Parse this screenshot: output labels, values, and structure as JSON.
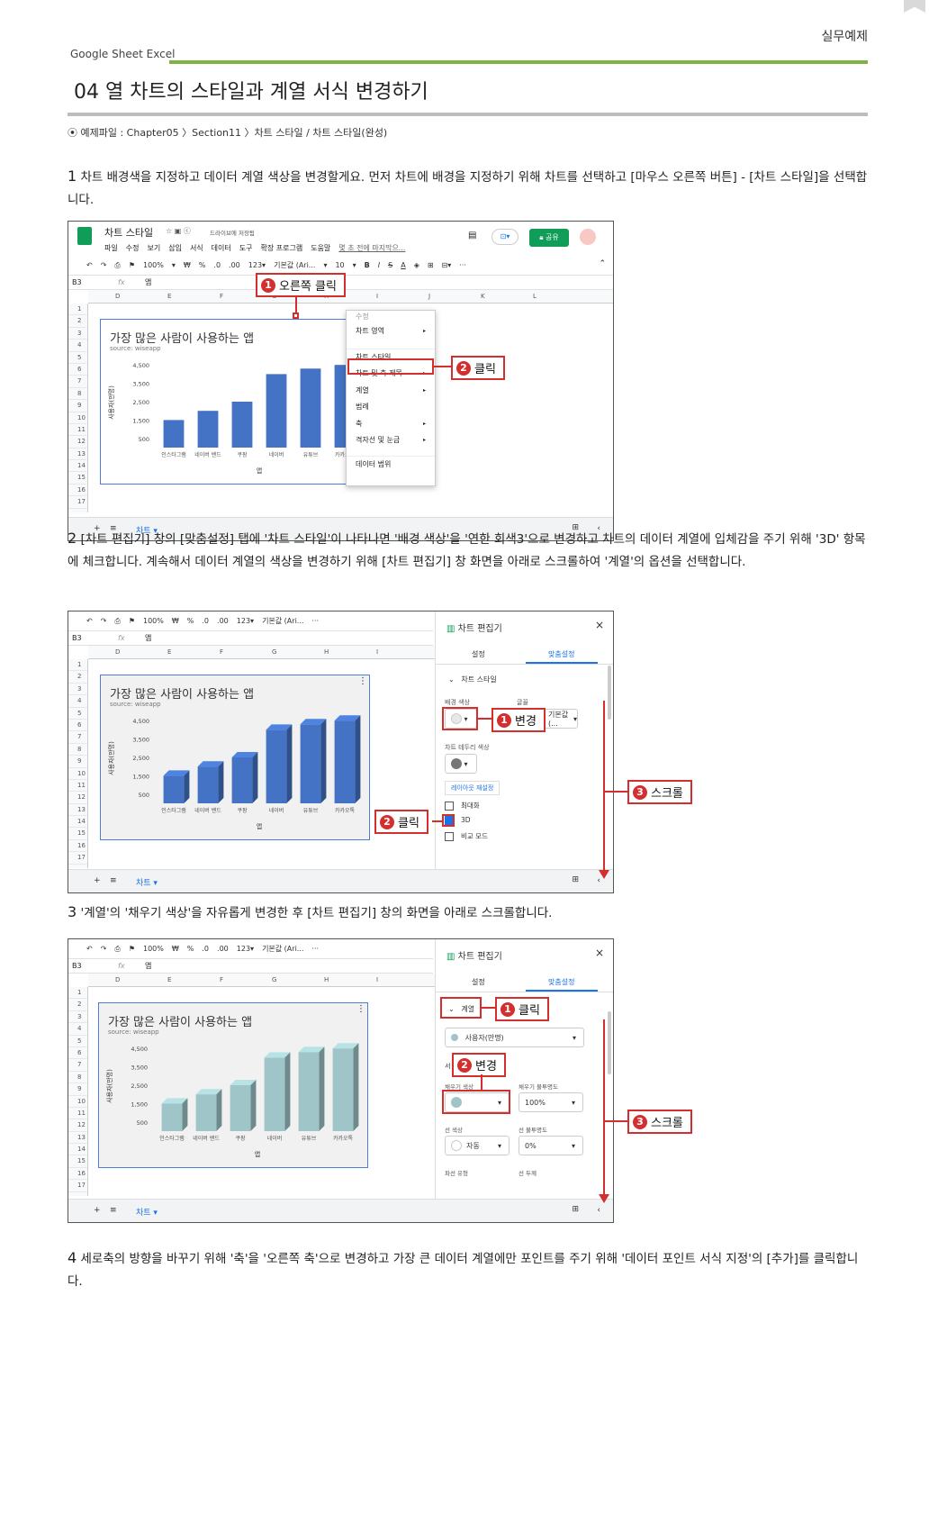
{
  "header": {
    "top_right": "실무예제",
    "product": "Google Sheet  Excel",
    "title": "04 열 차트의 스타일과 계열 서식 변경하기",
    "example_file": "예제파일 : Chapter05 〉Section11 〉차트 스타일 / 차트 스타일(완성)"
  },
  "steps": [
    {
      "num": "1",
      "text": "차트 배경색을 지정하고 데이터 계열 색상을 변경할게요. 먼저 차트에 배경을 지정하기 위해 차트를 선택하고 [마우스 오른쪽 버튼] - [차트 스타일]을 선택합니다."
    },
    {
      "num": "2",
      "text": "[차트 편집기] 창의 [맞춤설정] 탭에 '차트 스타일'이 나타나면 '배경 색상'을 '연한 회색3'으로 변경하고 차트의 데이터 계열에 입체감을 주기 위해 '3D' 항목에 체크합니다. 계속해서 데이터 계열의 색상을 변경하기 위해 [차트 편집기] 창 화면을 아래로 스크롤하여 '계열'의 옵션을 선택합니다."
    },
    {
      "num": "3",
      "text": "'계열'의 '채우기 색상'을 자유롭게 변경한 후 [차트 편집기] 창의 화면을 아래로 스크롤합니다."
    },
    {
      "num": "4",
      "text": "세로축의 방향을 바꾸기 위해 '축'을 '오른쪽 축'으로 변경하고 가장 큰 데이터 계열에만 포인트를 주기 위해 '데이터 포인트 서식 지정'의 [추가]를 클릭합니다."
    }
  ],
  "sheets": {
    "doc_title": "차트 스타일",
    "drive_status": "드라이브에 저장됨",
    "menus": [
      "파일",
      "수정",
      "보기",
      "삽입",
      "서식",
      "데이터",
      "도구",
      "확장 프로그램",
      "도움말"
    ],
    "last_edit": "몇 초 전에 마지막으...",
    "share": "공유",
    "toolbar": {
      "zoom": "100%",
      "currency": "₩",
      "percent": "%",
      "dec1": ".0",
      "dec2": ".00",
      "fmt": "123▾",
      "font": "기본값 (Ari...",
      "size": "10"
    },
    "cell_ref": "B3",
    "fx": "fx",
    "cell_value": "앱",
    "columns": [
      "D",
      "E",
      "F",
      "G",
      "H",
      "I",
      "J",
      "K",
      "L"
    ],
    "rows": [
      "1",
      "2",
      "3",
      "4",
      "5",
      "6",
      "7",
      "8",
      "9",
      "10",
      "11",
      "12",
      "13",
      "14",
      "15",
      "16",
      "17"
    ],
    "sheet_tab": "차트 ▾"
  },
  "chart_data": {
    "type": "bar",
    "title": "가장 많은 사람이 사용하는 앱",
    "subtitle": "source: wiseapp",
    "xlabel": "앱",
    "ylabel": "사용자(만명)",
    "categories": [
      "인스타그램",
      "네이버 밴드",
      "쿠팡",
      "네이버",
      "유튜브",
      "카카오톡"
    ],
    "values": [
      1500,
      2000,
      2500,
      4000,
      4300,
      4500
    ],
    "yticks": [
      "4,500",
      "3,500",
      "2,500",
      "1,500",
      "500"
    ],
    "ylim": [
      0,
      5000
    ],
    "colors": {
      "default": "#4472c4",
      "step3": "#9fc5c8"
    }
  },
  "context_menu": {
    "header": "수정",
    "items": [
      "차트 영역",
      "차트 스타일",
      "차트 및 축 제목",
      "계열",
      "범례",
      "축",
      "격자선 및 눈금",
      "데이터 범위"
    ]
  },
  "editor": {
    "title": "차트 편집기",
    "tab_setup": "설정",
    "tab_custom": "맞춤설정",
    "section_style": "차트 스타일",
    "bg_color": "배경 색상",
    "font": "글꼴",
    "font_value": "기본값(...",
    "border_color": "차트 테두리 색상",
    "reset_layout": "레이아웃 재설정",
    "maximize": "최대화",
    "three_d": "3D",
    "compare": "비교 모드",
    "series": "계열",
    "series_value": "사용자(만명)",
    "format": "서",
    "fill_color": "채우기 색상",
    "fill_opacity": "채우기 불투명도",
    "fill_opacity_value": "100%",
    "line_color": "선 색상",
    "line_color_value": "자동",
    "line_opacity": "선 불투명도",
    "line_opacity_value": "0%",
    "dash_type": "파선 유형",
    "line_width": "선 두께"
  },
  "callouts": {
    "s1_1": {
      "n": "1",
      "t": "오른쪽 클릭"
    },
    "s1_2": {
      "n": "2",
      "t": "클릭"
    },
    "s2_1": {
      "n": "1",
      "t": "변경"
    },
    "s2_2": {
      "n": "2",
      "t": "클릭"
    },
    "s2_3": {
      "n": "3",
      "t": "스크롤"
    },
    "s3_1": {
      "n": "1",
      "t": "클릭"
    },
    "s3_2": {
      "n": "2",
      "t": "변경"
    },
    "s3_3": {
      "n": "3",
      "t": "스크롤"
    }
  }
}
